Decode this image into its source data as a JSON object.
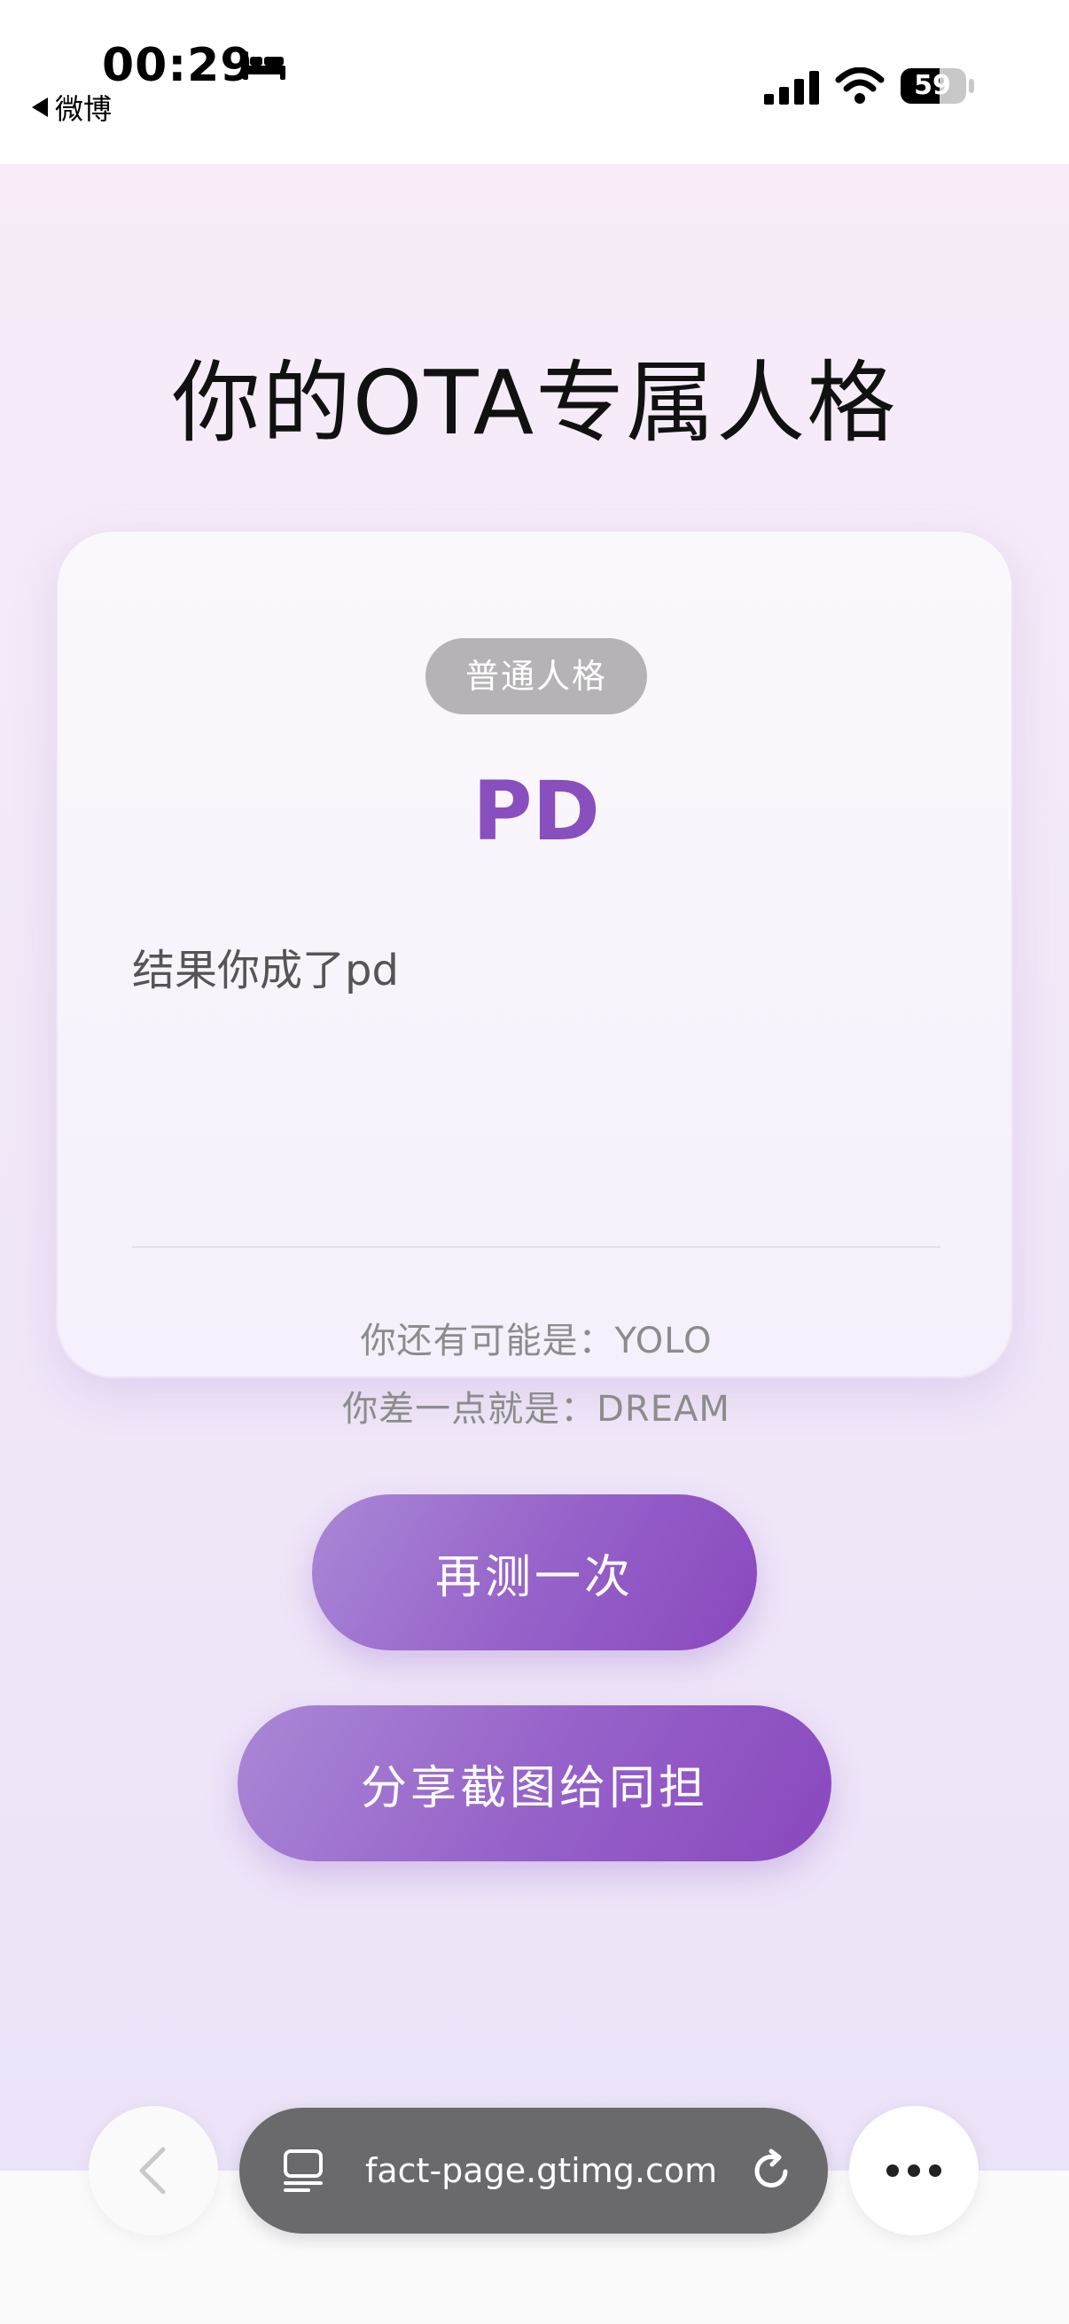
{
  "status_bar": {
    "time": "00:29",
    "back_app": "微博",
    "battery": "59"
  },
  "page": {
    "title": "你的OTA专属人格",
    "card": {
      "badge": "普通人格",
      "type_code": "PD",
      "description": "结果你成了pd",
      "alt1_label": "你还有可能是：",
      "alt1_value": "YOLO",
      "alt2_label": "你差一点就是：",
      "alt2_value": "DREAM"
    },
    "buttons": {
      "retry": "再测一次",
      "share": "分享截图给同担"
    },
    "accent_color": "#8a4fbf"
  },
  "browser": {
    "url": "fact-page.gtimg.com"
  }
}
